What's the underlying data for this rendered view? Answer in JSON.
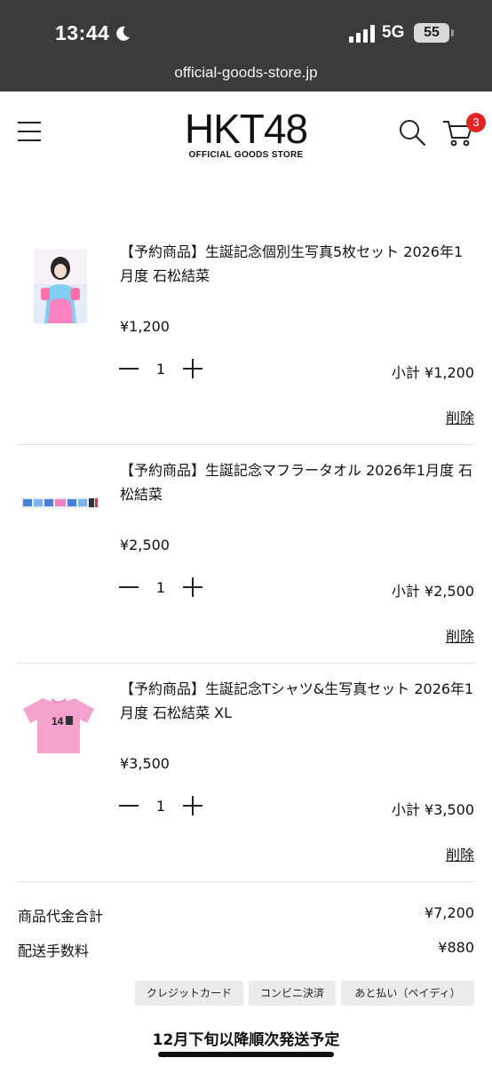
{
  "status_bar": {
    "time": "13:44",
    "network": "5G",
    "battery": "55"
  },
  "browser": {
    "url": "official-goods-store.jp"
  },
  "header": {
    "logo_main": "HKT48",
    "logo_sub": "OFFICIAL GOODS STORE",
    "cart_count": "3",
    "icons": [
      "menu-icon",
      "search-icon",
      "cart-icon"
    ]
  },
  "cart": {
    "items": [
      {
        "title": "【予約商品】生誕記念個別生写真5枚セット 2026年1月度 石松結菜",
        "price": "¥1,200",
        "quantity": "1",
        "subtotal": "小計 ¥1,200",
        "delete_label": "削除"
      },
      {
        "title": "【予約商品】生誕記念マフラータオル 2026年1月度 石松結菜",
        "price": "¥2,500",
        "quantity": "1",
        "subtotal": "小計 ¥2,500",
        "delete_label": "削除"
      },
      {
        "title": "【予約商品】生誕記念Tシャツ&生写真セット 2026年1月度 石松結菜 XL",
        "price": "¥3,500",
        "quantity": "1",
        "subtotal": "小計 ¥3,500",
        "delete_label": "削除"
      }
    ]
  },
  "totals": {
    "goods_label": "商品代金合計",
    "goods_value": "¥7,200",
    "shipping_label": "配送手数料",
    "shipping_value": "¥880"
  },
  "payment_methods": [
    "クレジットカード",
    "コンビニ決済",
    "あと払い（ペイディ）"
  ],
  "shipping_note": "12月下旬以降順次発送予定",
  "colors": {
    "chrome_bg": "#3b3b3b",
    "badge": "#e02525",
    "tshirt_pink": "#f4a3cf"
  }
}
